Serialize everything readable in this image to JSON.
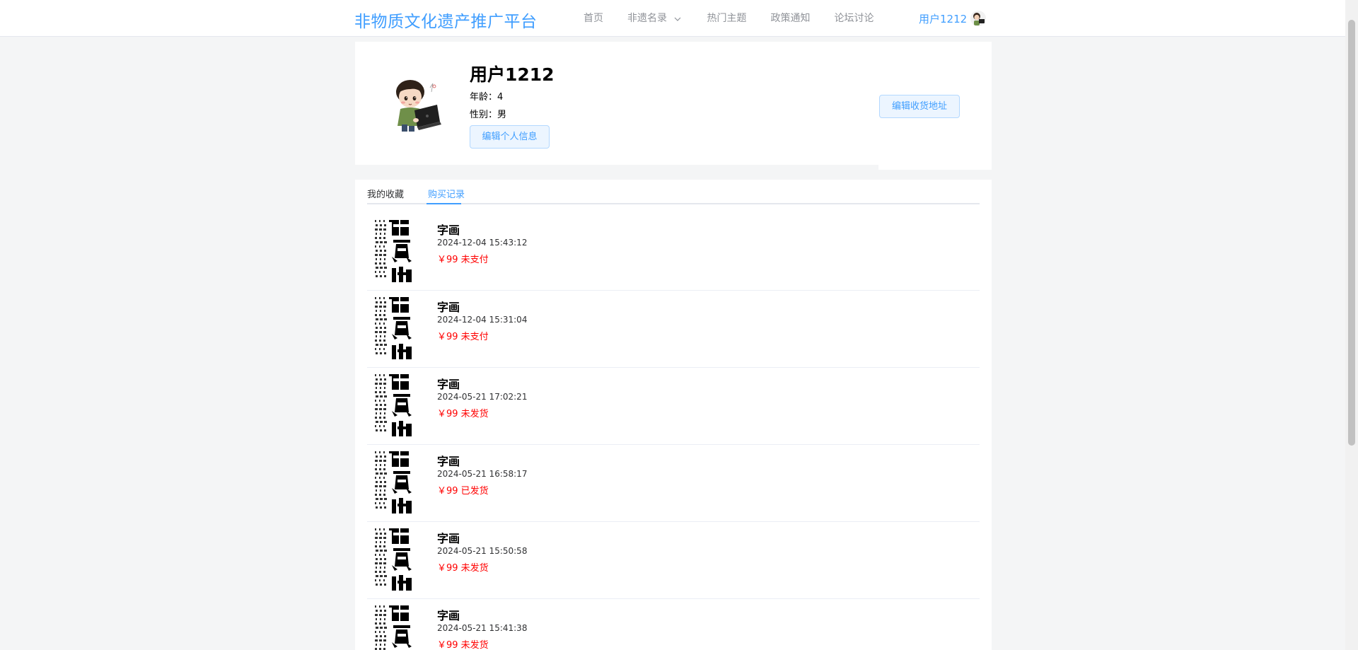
{
  "header": {
    "brand": "非物质文化遗产推广平台",
    "nav": [
      {
        "label": "首页",
        "has_dropdown": false
      },
      {
        "label": "非遗名录",
        "has_dropdown": true
      },
      {
        "label": "热门主题",
        "has_dropdown": false
      },
      {
        "label": "政策通知",
        "has_dropdown": false
      },
      {
        "label": "论坛讨论",
        "has_dropdown": false
      }
    ],
    "user_name": "用户1212"
  },
  "profile": {
    "name": "用户1212",
    "age_line": "年龄：4",
    "gender_line": "性别：男",
    "edit_info_label": "编辑个人信息",
    "edit_address_label": "编辑收货地址"
  },
  "tabs": {
    "favorites": "我的收藏",
    "orders": "购买记录",
    "active": "orders"
  },
  "orders": [
    {
      "title": "字画",
      "time": "2024-12-04 15:43:12",
      "price_status": "￥99 未支付"
    },
    {
      "title": "字画",
      "time": "2024-12-04 15:31:04",
      "price_status": "￥99 未支付"
    },
    {
      "title": "字画",
      "time": "2024-05-21 17:02:21",
      "price_status": "￥99 未发货"
    },
    {
      "title": "字画",
      "time": "2024-05-21 16:58:17",
      "price_status": "￥99 已发货"
    },
    {
      "title": "字画",
      "time": "2024-05-21 15:50:58",
      "price_status": "￥99 未发货"
    },
    {
      "title": "字画",
      "time": "2024-05-21 15:41:38",
      "price_status": "￥99 未发货"
    }
  ],
  "theme": {
    "accent": "#409eff",
    "status_red": "#ff0000",
    "page_bg": "#f4f5f6"
  },
  "icons": {
    "nav_dropdown": "chevron-down-icon",
    "avatar": "cartoon-boy-laptop-avatar",
    "thumb": "calligraphy-scroll-thumbnail"
  }
}
